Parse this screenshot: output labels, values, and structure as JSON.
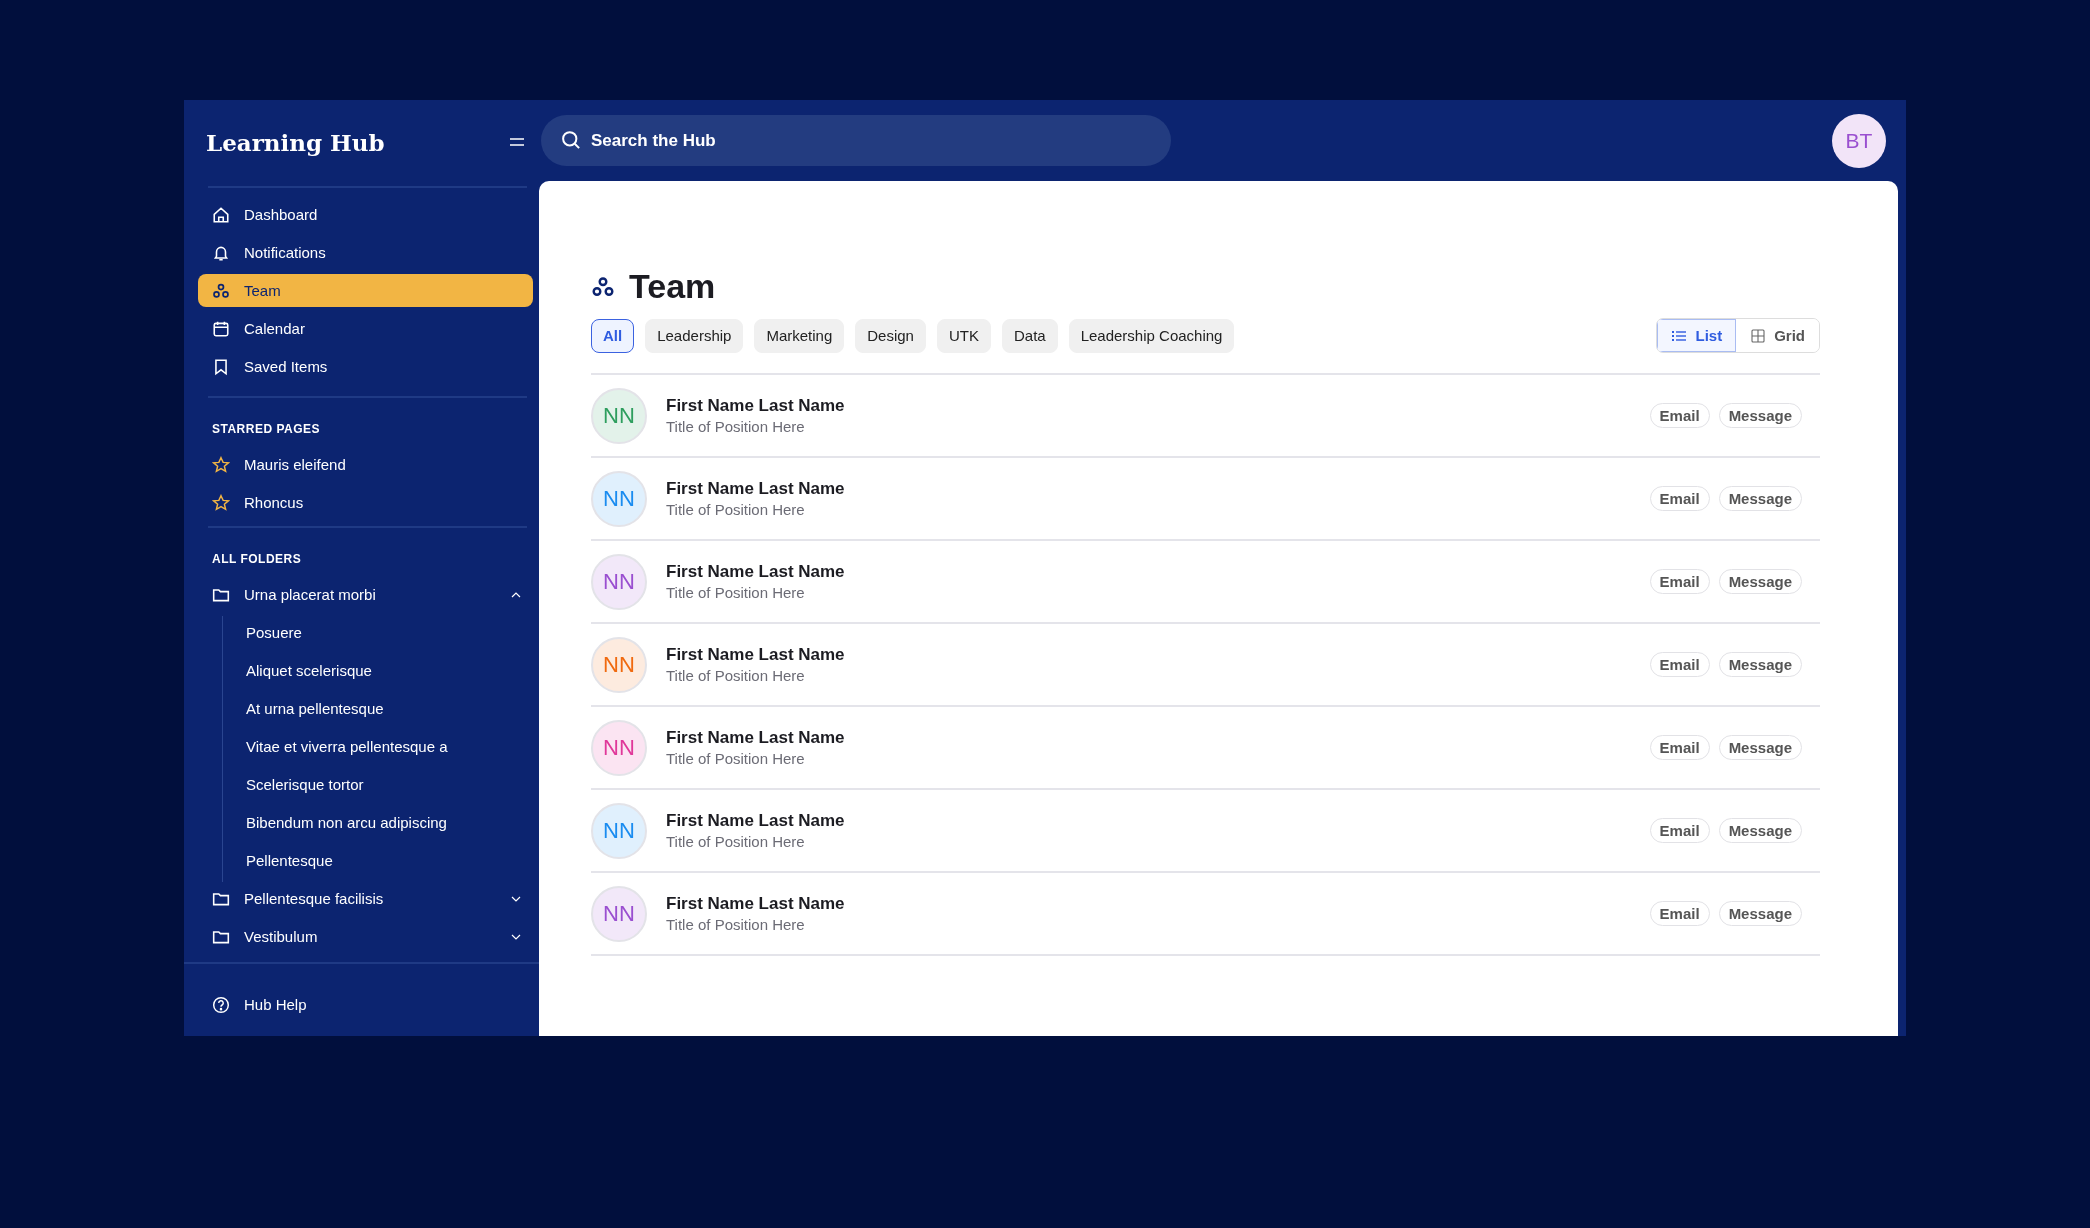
{
  "sidebar": {
    "title": "Learning Hub",
    "nav": [
      {
        "label": "Dashboard",
        "kind": "home",
        "selected": false
      },
      {
        "label": "Notifications",
        "kind": "bell",
        "selected": false
      },
      {
        "label": "Team",
        "kind": "team",
        "selected": true
      },
      {
        "label": "Calendar",
        "kind": "calendar",
        "selected": false
      },
      {
        "label": "Saved Items",
        "kind": "bookmark",
        "selected": false
      }
    ],
    "starred": {
      "heading": "STARRED PAGES",
      "items": [
        {
          "label": "Mauris eleifend"
        },
        {
          "label": "Rhoncus"
        }
      ]
    },
    "folders": {
      "heading": "ALL FOLDERS",
      "items": [
        {
          "label": "Urna placerat morbi",
          "expanded": true,
          "children": [
            {
              "label": "Posuere"
            },
            {
              "label": "Aliquet scelerisque"
            },
            {
              "label": "At urna pellentesque"
            },
            {
              "label": "Vitae et viverra pellentesque a"
            },
            {
              "label": "Scelerisque tortor"
            },
            {
              "label": "Bibendum non arcu adipiscing"
            },
            {
              "label": "Pellentesque"
            }
          ]
        },
        {
          "label": "Pellentesque facilisis",
          "expanded": false
        },
        {
          "label": "Vestibulum",
          "expanded": false
        }
      ]
    },
    "help": "Hub Help"
  },
  "search": {
    "placeholder": "Search the Hub"
  },
  "user": {
    "initials": "BT"
  },
  "page": {
    "title": "Team",
    "filters": [
      {
        "label": "All",
        "selected": true
      },
      {
        "label": "Leadership",
        "selected": false
      },
      {
        "label": "Marketing",
        "selected": false
      },
      {
        "label": "Design",
        "selected": false
      },
      {
        "label": "UTK",
        "selected": false
      },
      {
        "label": "Data",
        "selected": false
      },
      {
        "label": "Leadership Coaching",
        "selected": false
      }
    ],
    "views": [
      {
        "label": "List",
        "kind": "list",
        "selected": true
      },
      {
        "label": "Grid",
        "kind": "grid",
        "selected": false
      }
    ],
    "members": [
      {
        "initials": "NN",
        "name": "First Name Last Name",
        "title": "Title of Position Here",
        "color": "#2e9e5e",
        "actions": [
          "Email",
          "Message"
        ]
      },
      {
        "initials": "NN",
        "name": "First Name Last Name",
        "title": "Title of Position Here",
        "color": "#1a8cf0",
        "actions": [
          "Email",
          "Message"
        ]
      },
      {
        "initials": "NN",
        "name": "First Name Last Name",
        "title": "Title of Position Here",
        "color": "#9a4fd0",
        "actions": [
          "Email",
          "Message"
        ]
      },
      {
        "initials": "NN",
        "name": "First Name Last Name",
        "title": "Title of Position Here",
        "color": "#f06a10",
        "actions": [
          "Email",
          "Message"
        ]
      },
      {
        "initials": "NN",
        "name": "First Name Last Name",
        "title": "Title of Position Here",
        "color": "#e0389a",
        "actions": [
          "Email",
          "Message"
        ]
      },
      {
        "initials": "NN",
        "name": "First Name Last Name",
        "title": "Title of Position Here",
        "color": "#1a8cf0",
        "actions": [
          "Email",
          "Message"
        ]
      },
      {
        "initials": "NN",
        "name": "First Name Last Name",
        "title": "Title of Position Here",
        "color": "#9a4fd0",
        "actions": [
          "Email",
          "Message"
        ]
      }
    ]
  }
}
